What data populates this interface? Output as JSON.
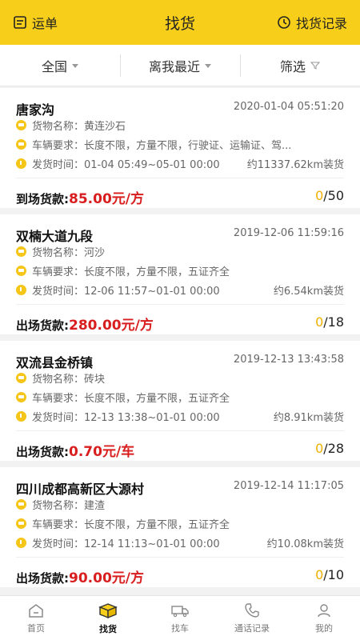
{
  "header": {
    "left_label": "运单",
    "title": "找货",
    "right_label": "找货记录",
    "background": "#f7cf1a"
  },
  "filters": [
    {
      "label": "全国"
    },
    {
      "label": "离我最近"
    },
    {
      "label": "筛选"
    }
  ],
  "cards": [
    {
      "place": "唐家沟",
      "time": "2020-01-04 05:51:20",
      "goods": "货物名称：黄连沙石",
      "vehicle": "车辆要求：长度不限，方量不限，行驶证、运输证、驾...",
      "ship": "发货时间：01-04 05:49~05-01 00:00",
      "distance": "约11337.62km装货",
      "price_label": "到场货款:",
      "price": "85.00元/方",
      "count_zero": "0",
      "count_total": "/50"
    },
    {
      "place": "双楠大道九段",
      "time": "2019-12-06 11:59:16",
      "goods": "货物名称：河沙",
      "vehicle": "车辆要求：长度不限，方量不限，五证齐全",
      "ship": "发货时间：12-06 11:57~01-01 00:00",
      "distance": "约6.54km装货",
      "price_label": "出场货款:",
      "price": "280.00元/方",
      "count_zero": "0",
      "count_total": "/18"
    },
    {
      "place": "双流县金桥镇",
      "time": "2019-12-13 13:43:58",
      "goods": "货物名称：砖块",
      "vehicle": "车辆要求：长度不限，方量不限，五证齐全",
      "ship": "发货时间：12-13 13:38~01-01 00:00",
      "distance": "约8.91km装货",
      "price_label": "出场货款:",
      "price": "0.70元/车",
      "count_zero": "0",
      "count_total": "/28"
    },
    {
      "place": "四川成都高新区大源村",
      "time": "2019-12-14 11:17:05",
      "goods": "货物名称：建渣",
      "vehicle": "车辆要求：长度不限，方量不限，五证齐全",
      "ship": "发货时间：12-14 11:13~01-01 00:00",
      "distance": "约10.08km装货",
      "price_label": "出场货款:",
      "price": "90.00元/方",
      "count_zero": "0",
      "count_total": "/10"
    }
  ],
  "tabs": [
    {
      "label": "首页",
      "icon": "home-icon"
    },
    {
      "label": "找货",
      "icon": "box-icon"
    },
    {
      "label": "找车",
      "icon": "truck-icon"
    },
    {
      "label": "通话记录",
      "icon": "phone-icon"
    },
    {
      "label": "我的",
      "icon": "person-icon"
    }
  ],
  "colors": {
    "accent": "#f7cf1a",
    "price": "#d81e1e",
    "count_zero": "#f0b000"
  }
}
